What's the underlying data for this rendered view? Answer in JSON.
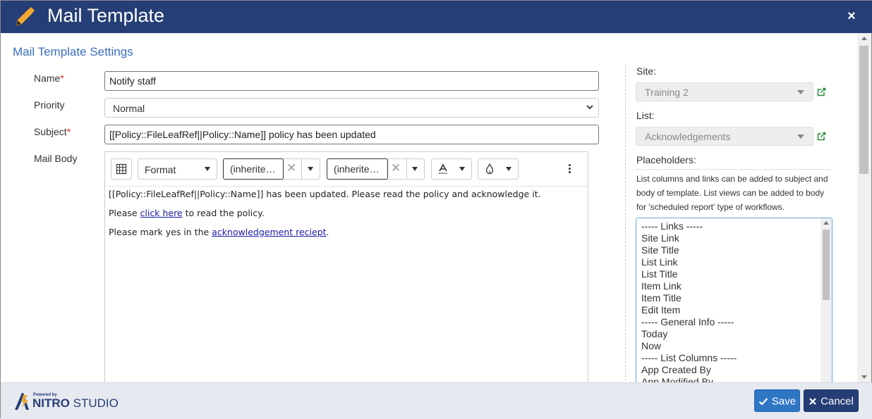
{
  "window": {
    "title": "Mail Template",
    "close_label": "×"
  },
  "section_title": "Mail Template Settings",
  "form": {
    "name_label": "Name",
    "name_value": "Notify staff",
    "priority_label": "Priority",
    "priority_value": "Normal",
    "subject_label": "Subject",
    "subject_value": "[[Policy::FileLeafRef||Policy::Name]] policy has been updated",
    "mail_body_label": "Mail Body",
    "required_marker": "*"
  },
  "editor": {
    "toolbar": {
      "format_label": "Format",
      "font_family_value": "(inherite…",
      "font_size_value": "(inherite…"
    },
    "body": {
      "line1": "[[Policy::FileLeafRef||Policy::Name]] has been updated. Please read the policy and acknowledge it.",
      "line2_pre": "Please ",
      "line2_link": "click here",
      "line2_post": " to read the policy.",
      "line3_pre": "Please mark yes in the ",
      "line3_link": "acknowledgement reciept",
      "line3_post": "."
    }
  },
  "side": {
    "site_label": "Site:",
    "site_value": "Training 2",
    "list_label": "List:",
    "list_value": "Acknowledgements",
    "placeholders_label": "Placeholders:",
    "help_text": "List columns and links can be added to subject and body of template. List views can be added to body for 'scheduled report' type of workflows.",
    "placeholder_options": [
      "----- Links -----",
      "Site Link",
      "Site Title",
      "List Link",
      "List Title",
      "Item Link",
      "Item Title",
      "Edit Item",
      "----- General Info -----",
      "Today",
      "Now",
      "----- List Columns -----",
      "App Created By",
      "App Modified By"
    ]
  },
  "footer": {
    "powered_by": "Powered by",
    "brand_bold": "NITRO",
    "brand_rest": " STUDIO",
    "save_label": "Save",
    "cancel_label": "Cancel"
  },
  "colors": {
    "header_bg": "#253e75",
    "section_title": "#3a6fbf",
    "save_bg": "#2f76c4",
    "cancel_bg": "#253e75",
    "pencil": "#f0a830",
    "external_link": "#2a8a3a"
  }
}
